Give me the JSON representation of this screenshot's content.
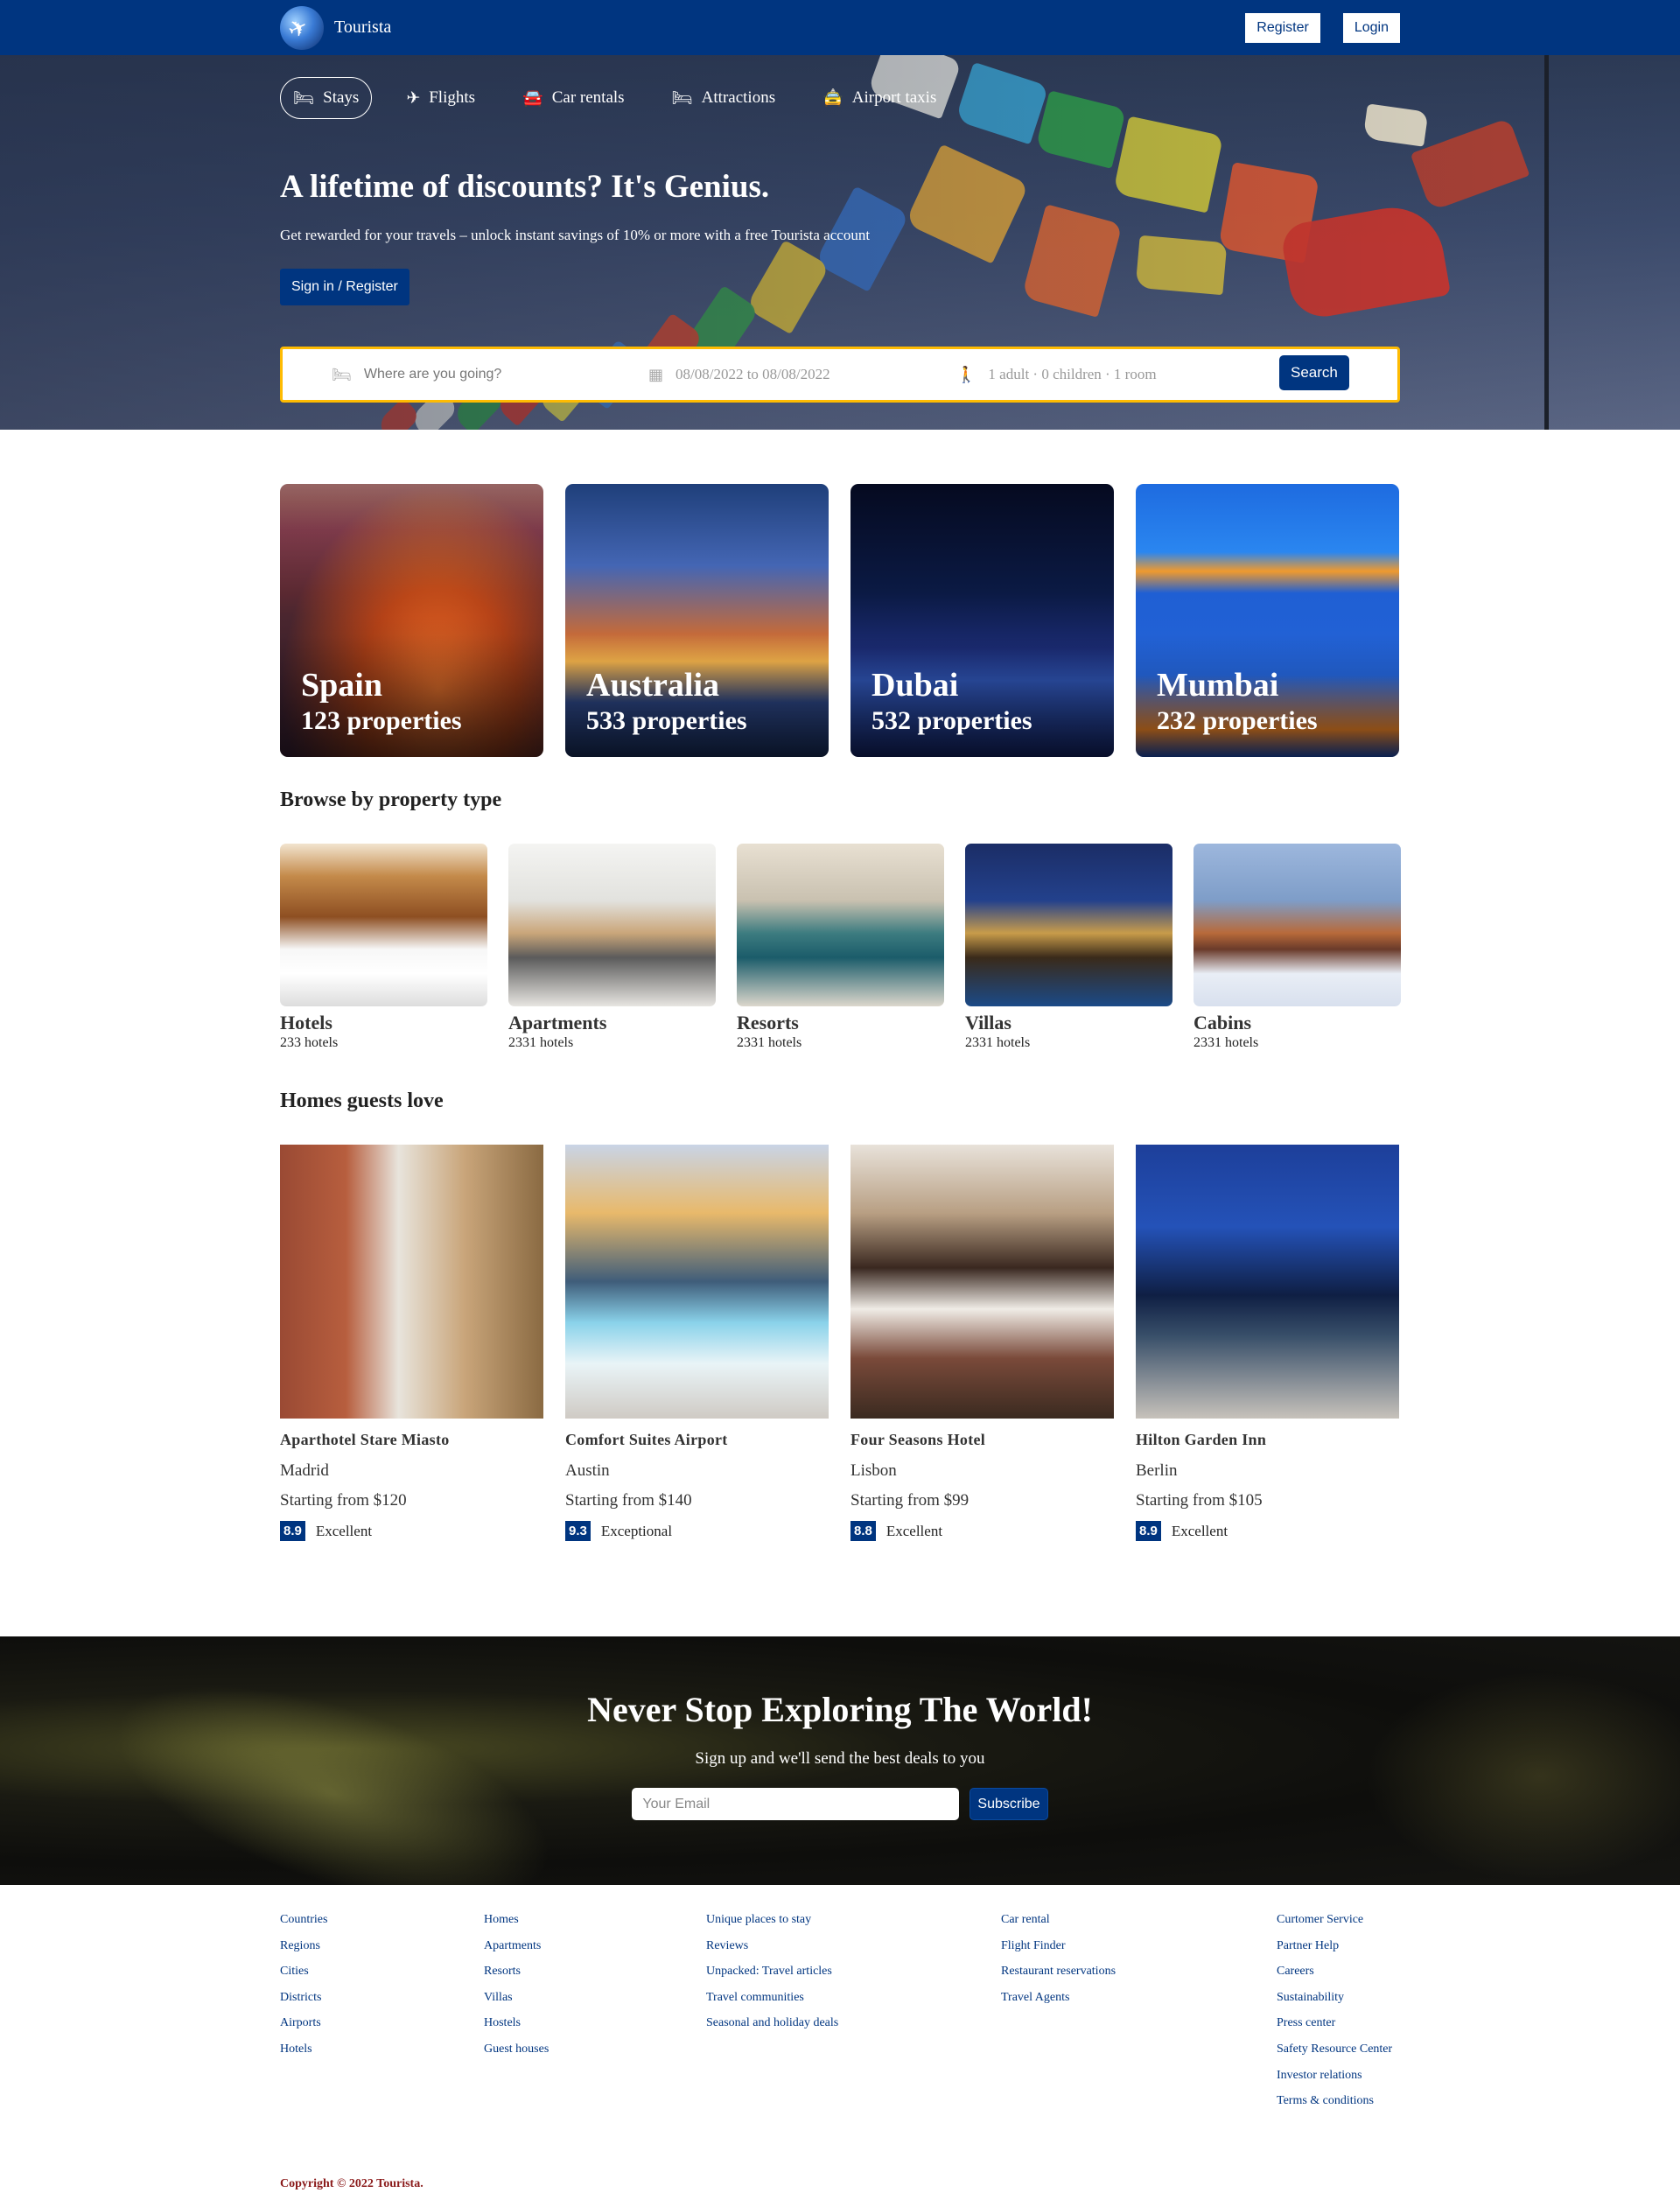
{
  "brand": {
    "name": "Tourista",
    "logo_icon": "globe-plane-icon"
  },
  "header": {
    "register_label": "Register",
    "login_label": "Login"
  },
  "hero": {
    "tabs": [
      {
        "label": "Stays",
        "icon": "bed-icon"
      },
      {
        "label": "Flights",
        "icon": "plane-icon"
      },
      {
        "label": "Car rentals",
        "icon": "car-icon"
      },
      {
        "label": "Attractions",
        "icon": "bed-icon"
      },
      {
        "label": "Airport taxis",
        "icon": "taxi-icon"
      }
    ],
    "title": "A lifetime of discounts? It's Genius.",
    "subtitle": "Get rewarded for your travels – unlock instant savings of 10% or more with a free Tourista account",
    "cta": "Sign in / Register"
  },
  "search": {
    "destination_placeholder": "Where are you going?",
    "dates": "08/08/2022 to 08/08/2022",
    "options": "1 adult · 0 children · 1 room",
    "button": "Search"
  },
  "featured": [
    {
      "title": "Spain",
      "properties": "123 properties"
    },
    {
      "title": "Australia",
      "properties": "533 properties"
    },
    {
      "title": "Dubai",
      "properties": "532 properties"
    },
    {
      "title": "Mumbai",
      "properties": "232 properties"
    }
  ],
  "browse": {
    "title": "Browse by property type",
    "items": [
      {
        "name": "Hotels",
        "count": "233 hotels"
      },
      {
        "name": "Apartments",
        "count": "2331 hotels"
      },
      {
        "name": "Resorts",
        "count": "2331 hotels"
      },
      {
        "name": "Villas",
        "count": "2331 hotels"
      },
      {
        "name": "Cabins",
        "count": "2331 hotels"
      }
    ]
  },
  "homes": {
    "title": "Homes guests love",
    "items": [
      {
        "name": "Aparthotel Stare Miasto",
        "city": "Madrid",
        "price": "Starting from $120",
        "score": "8.9",
        "rating_text": "Excellent"
      },
      {
        "name": "Comfort Suites Airport",
        "city": "Austin",
        "price": "Starting from $140",
        "score": "9.3",
        "rating_text": "Exceptional"
      },
      {
        "name": "Four Seasons Hotel",
        "city": "Lisbon",
        "price": "Starting from $99",
        "score": "8.8",
        "rating_text": "Excellent"
      },
      {
        "name": "Hilton Garden Inn",
        "city": "Berlin",
        "price": "Starting from $105",
        "score": "8.9",
        "rating_text": "Excellent"
      }
    ]
  },
  "newsletter": {
    "title": "Never Stop Exploring The World!",
    "subtitle": "Sign up and we'll send the best deals to you",
    "email_placeholder": "Your Email",
    "button": "Subscribe"
  },
  "footer": {
    "columns": [
      [
        "Countries",
        "Regions",
        "Cities",
        "Districts",
        "Airports",
        "Hotels"
      ],
      [
        "Homes",
        "Apartments",
        "Resorts",
        "Villas",
        "Hostels",
        "Guest houses"
      ],
      [
        "Unique places to stay",
        "Reviews",
        "Unpacked: Travel articles",
        "Travel communities",
        "Seasonal and holiday deals"
      ],
      [
        "Car rental",
        "Flight Finder",
        "Restaurant reservations",
        "Travel Agents"
      ],
      [
        "Curtomer Service",
        "Partner Help",
        "Careers",
        "Sustainability",
        "Press center",
        "Safety Resource Center",
        "Investor relations",
        "Terms & conditions"
      ]
    ],
    "copyright": "Copyright © 2022 Tourista."
  },
  "colors": {
    "primary": "#003580",
    "accent": "#febb02",
    "copyright": "#8a1a1a"
  }
}
